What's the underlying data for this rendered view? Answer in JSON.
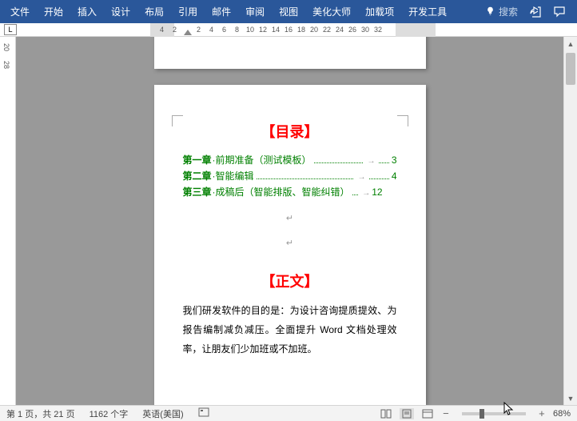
{
  "menu": {
    "items": [
      "文件",
      "开始",
      "插入",
      "设计",
      "布局",
      "引用",
      "邮件",
      "审阅",
      "视图",
      "美化大师",
      "加载项",
      "开发工具"
    ],
    "search_placeholder": "搜索"
  },
  "ruler": {
    "l_label": "L",
    "h_ticks": [
      4,
      2,
      2,
      4,
      6,
      8,
      10,
      12,
      14,
      16,
      18,
      20,
      22,
      24,
      26,
      30,
      32
    ],
    "v_ticks": [
      20,
      28
    ]
  },
  "doc": {
    "toc_title": "【目录】",
    "toc": [
      {
        "chap": "第一章",
        "name": "·前期准备（测试模板）",
        "page": "3"
      },
      {
        "chap": "第二章",
        "name": "·智能编辑",
        "page": "4"
      },
      {
        "chap": "第三章",
        "name": "·成稿后（智能排版、智能纠错）",
        "page": "12"
      }
    ],
    "body_title": "【正文】",
    "body_text": "我们研发软件的目的是：为设计咨询提质提效、为报告编制减负减压。全面提升 Word 文档处理效率，让朋友们少加班或不加班。"
  },
  "status": {
    "page": "第 1 页，共 21 页",
    "words": "1162 个字",
    "lang": "英语(美国)",
    "zoom": "68%"
  }
}
